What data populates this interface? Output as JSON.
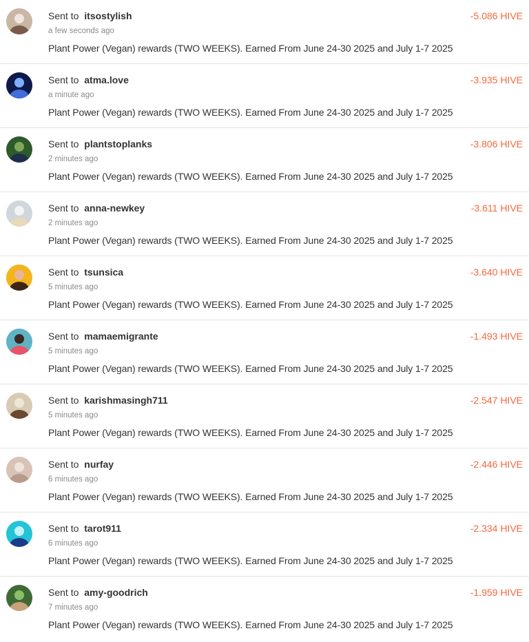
{
  "transactions": [
    {
      "prefix": "Sent to",
      "recipient": "itsostylish",
      "time": "a few seconds ago",
      "memo": "Plant Power (Vegan) rewards (TWO WEEKS). Earned From June 24-30 2025 and July 1-7 2025",
      "amount": "-5.086 HIVE",
      "avatar": {
        "bg": "#c9b6a4",
        "fg": "#7a5a48",
        "accent": "#efe6dd"
      }
    },
    {
      "prefix": "Sent to",
      "recipient": "atma.love",
      "time": "a minute ago",
      "memo": "Plant Power (Vegan) rewards (TWO WEEKS). Earned From June 24-30 2025 and July 1-7 2025",
      "amount": "-3.935 HIVE",
      "avatar": {
        "bg": "#0d1a4a",
        "fg": "#3f6fd8",
        "accent": "#7fb0ff"
      }
    },
    {
      "prefix": "Sent to",
      "recipient": "plantstoplanks",
      "time": "2 minutes ago",
      "memo": "Plant Power (Vegan) rewards (TWO WEEKS). Earned From June 24-30 2025 and July 1-7 2025",
      "amount": "-3.806 HIVE",
      "avatar": {
        "bg": "#2f5a2a",
        "fg": "#1c2e4a",
        "accent": "#7fa85a"
      }
    },
    {
      "prefix": "Sent to",
      "recipient": "anna-newkey",
      "time": "2 minutes ago",
      "memo": "Plant Power (Vegan) rewards (TWO WEEKS). Earned From June 24-30 2025 and July 1-7 2025",
      "amount": "-3.611 HIVE",
      "avatar": {
        "bg": "#cfd6dc",
        "fg": "#e8d9b8",
        "accent": "#f4f4f4"
      }
    },
    {
      "prefix": "Sent to",
      "recipient": "tsunsica",
      "time": "5 minutes ago",
      "memo": "Plant Power (Vegan) rewards (TWO WEEKS). Earned From June 24-30 2025 and July 1-7 2025",
      "amount": "-3.640 HIVE",
      "avatar": {
        "bg": "#f2b51c",
        "fg": "#3b2618",
        "accent": "#e9b59a"
      }
    },
    {
      "prefix": "Sent to",
      "recipient": "mamaemigrante",
      "time": "5 minutes ago",
      "memo": "Plant Power (Vegan) rewards (TWO WEEKS). Earned From June 24-30 2025 and July 1-7 2025",
      "amount": "-1.493 HIVE",
      "avatar": {
        "bg": "#5fb3c4",
        "fg": "#e8546a",
        "accent": "#3b2a22"
      }
    },
    {
      "prefix": "Sent to",
      "recipient": "karishmasingh711",
      "time": "5 minutes ago",
      "memo": "Plant Power (Vegan) rewards (TWO WEEKS). Earned From June 24-30 2025 and July 1-7 2025",
      "amount": "-2.547 HIVE",
      "avatar": {
        "bg": "#d8cbb5",
        "fg": "#6a4a2e",
        "accent": "#f0e6d6"
      }
    },
    {
      "prefix": "Sent to",
      "recipient": "nurfay",
      "time": "6 minutes ago",
      "memo": "Plant Power (Vegan) rewards (TWO WEEKS). Earned From June 24-30 2025 and July 1-7 2025",
      "amount": "-2.446 HIVE",
      "avatar": {
        "bg": "#d9c3b6",
        "fg": "#b89a8a",
        "accent": "#efe2da"
      }
    },
    {
      "prefix": "Sent to",
      "recipient": "tarot911",
      "time": "6 minutes ago",
      "memo": "Plant Power (Vegan) rewards (TWO WEEKS). Earned From June 24-30 2025 and July 1-7 2025",
      "amount": "-2.334 HIVE",
      "avatar": {
        "bg": "#23c4d6",
        "fg": "#1a3a8a",
        "accent": "#bff3f8"
      }
    },
    {
      "prefix": "Sent to",
      "recipient": "amy-goodrich",
      "time": "7 minutes ago",
      "memo": "Plant Power (Vegan) rewards (TWO WEEKS). Earned From June 24-30 2025 and July 1-7 2025",
      "amount": "-1.959 HIVE",
      "avatar": {
        "bg": "#3e6a36",
        "fg": "#c9a27a",
        "accent": "#8cbf6a"
      }
    }
  ],
  "colors": {
    "amount": "#f4683c",
    "text": "#333333",
    "muted": "#8a8a8a",
    "divider": "#e4e4e4"
  }
}
